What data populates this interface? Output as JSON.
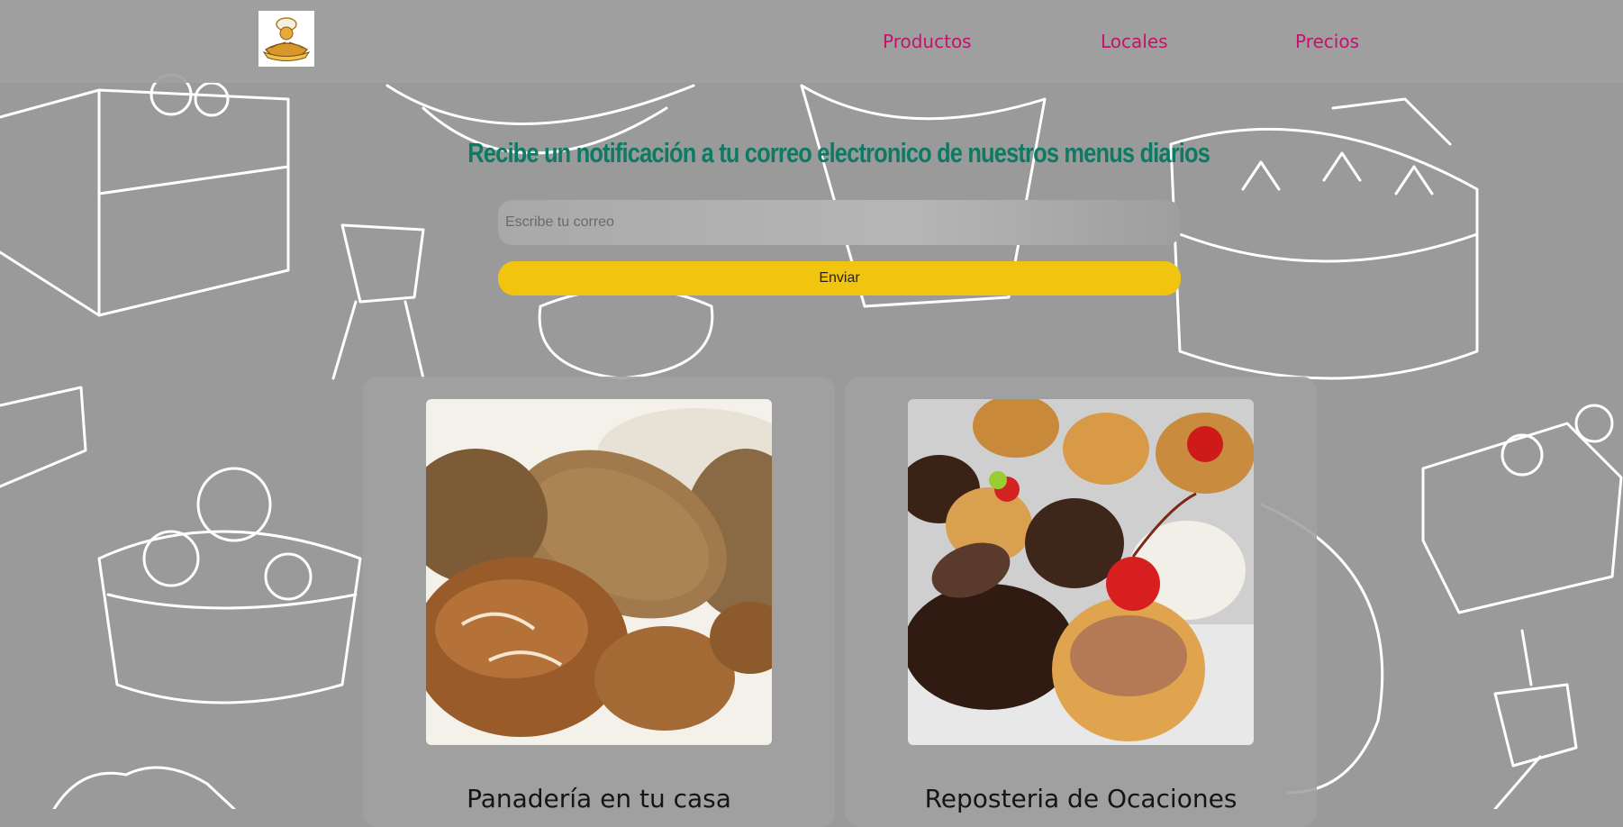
{
  "header": {
    "logo_alt": "Logo panadería",
    "nav": [
      {
        "label": "Productos"
      },
      {
        "label": "Locales"
      },
      {
        "label": "Precios"
      }
    ]
  },
  "newsletter": {
    "title": "Recibe un notificación a tu correo electronico de nuestros menus diarios",
    "email_placeholder": "Escribe tu correo",
    "email_value": "",
    "submit_label": "Enviar"
  },
  "cards": [
    {
      "title": "Panadería en tu casa",
      "image": "bread-photo"
    },
    {
      "title": "Reposteria de Ocaciones",
      "image": "pastries-photo"
    }
  ],
  "colors": {
    "background": "#9a9a9a",
    "nav_link": "#c2136d",
    "title": "#0f7a63",
    "button": "#f1c40f"
  }
}
